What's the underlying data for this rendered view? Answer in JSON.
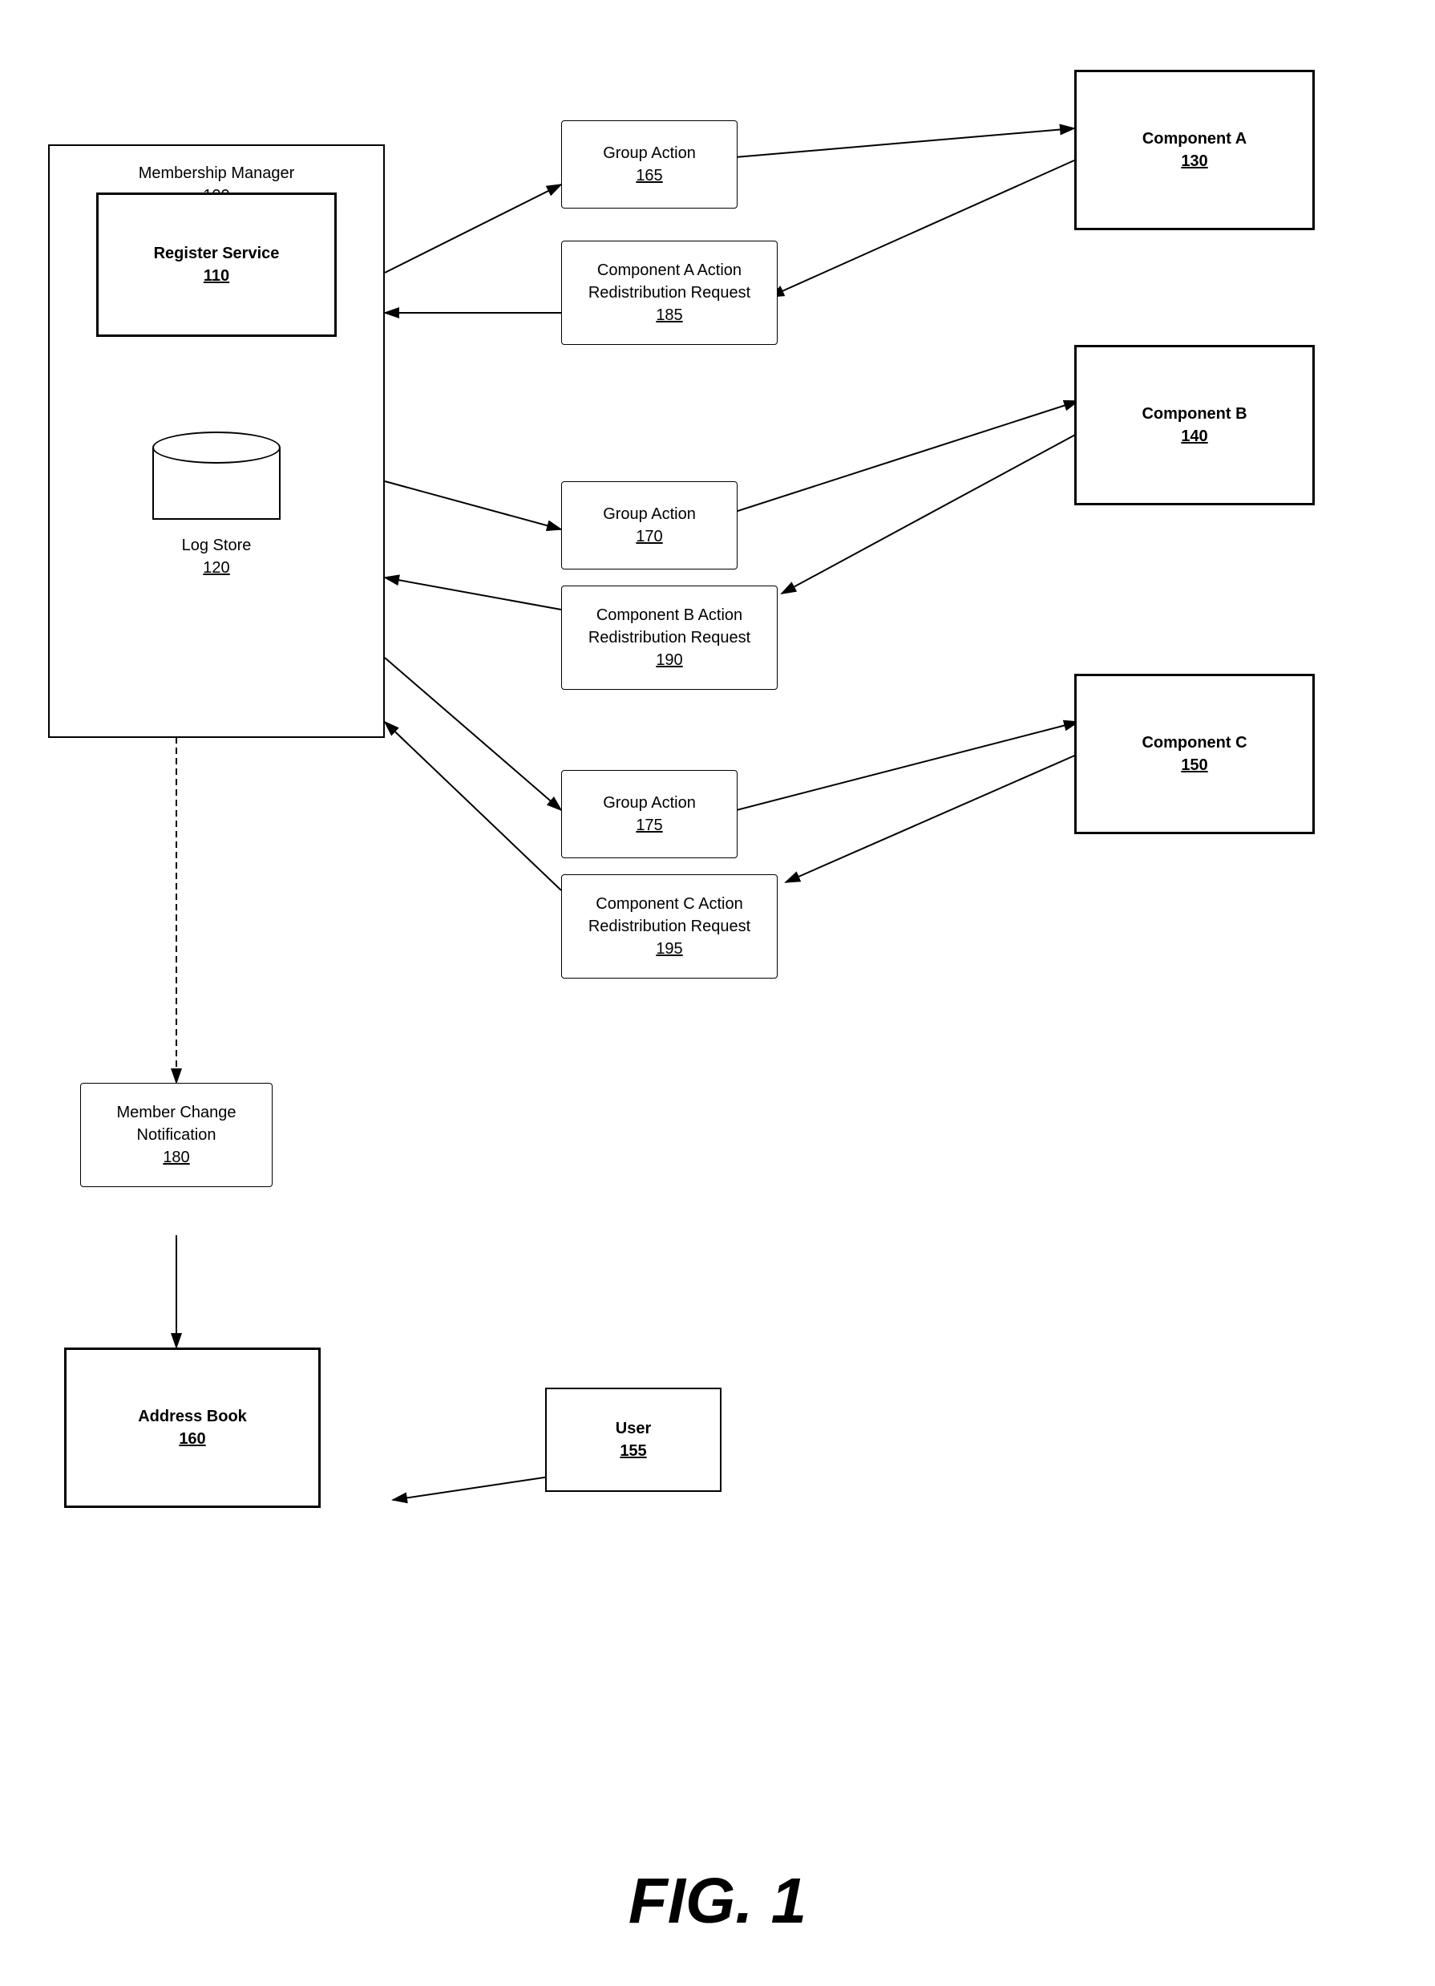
{
  "diagram": {
    "title": "FIG. 1",
    "membership_manager": {
      "label": "Membership Manager",
      "number": "100"
    },
    "register_service": {
      "label": "Register Service",
      "number": "110"
    },
    "log_store": {
      "label": "Log Store",
      "number": "120"
    },
    "component_a": {
      "label": "Component A",
      "number": "130"
    },
    "component_b": {
      "label": "Component B",
      "number": "140"
    },
    "component_c": {
      "label": "Component C",
      "number": "150"
    },
    "user": {
      "label": "User",
      "number": "155"
    },
    "address_book": {
      "label": "Address Book",
      "number": "160"
    },
    "group_action_165": {
      "label": "Group Action",
      "number": "165"
    },
    "component_a_action": {
      "label": "Component A Action\nRedistribution Request",
      "number": "185"
    },
    "group_action_170": {
      "label": "Group Action",
      "number": "170"
    },
    "component_b_action": {
      "label": "Component B Action\nRedistribution Request",
      "number": "190"
    },
    "group_action_175": {
      "label": "Group Action",
      "number": "175"
    },
    "component_c_action": {
      "label": "Component C Action\nRedistribution Request",
      "number": "195"
    },
    "member_change": {
      "label": "Member Change\nNotification",
      "number": "180"
    }
  }
}
